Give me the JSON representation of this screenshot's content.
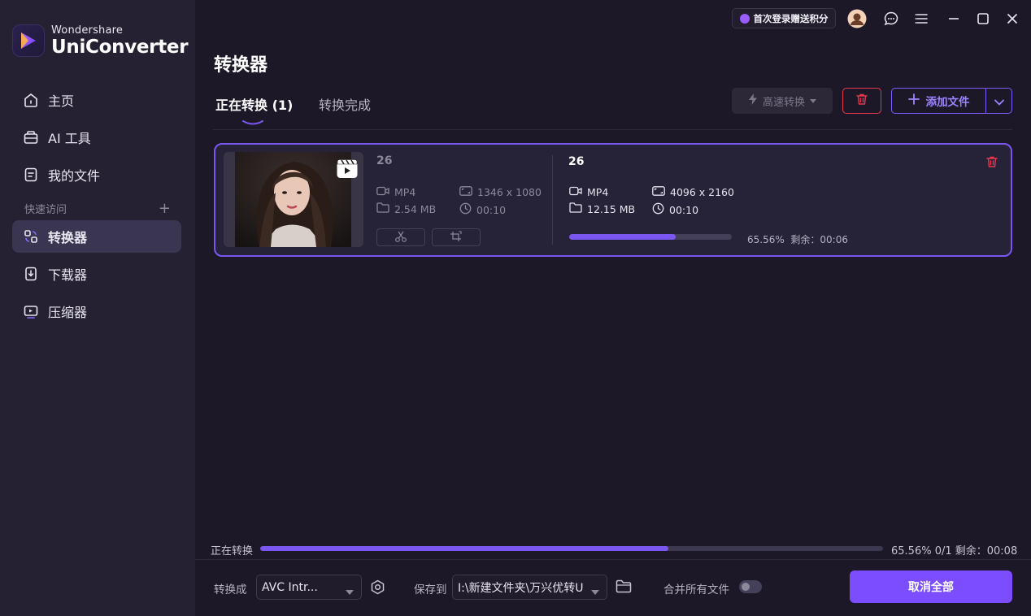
{
  "app": {
    "brand": "Wondershare",
    "product": "UniConverter"
  },
  "sidebar": {
    "items": [
      {
        "label": "主页",
        "icon": "home-icon"
      },
      {
        "label": "AI 工具",
        "icon": "ai-tools-icon"
      },
      {
        "label": "我的文件",
        "icon": "my-files-icon"
      },
      {
        "label": "转换器",
        "icon": "converter-icon",
        "active": true
      },
      {
        "label": "下载器",
        "icon": "downloader-icon"
      },
      {
        "label": "压缩器",
        "icon": "compressor-icon"
      }
    ],
    "quick_access_label": "快速访问",
    "quick_access_add": "+"
  },
  "topbar": {
    "promo_text": "首次登录赠送积分"
  },
  "main": {
    "title": "转换器",
    "tabs": [
      {
        "label": "正在转换 (1)",
        "active": true
      },
      {
        "label": "转换完成",
        "active": false
      }
    ],
    "toolbar": {
      "fast_convert_label": "高速转换",
      "add_file_label": "添加文件"
    }
  },
  "file": {
    "source": {
      "name": "26",
      "format": "MP4",
      "resolution": "1346 x 1080",
      "size": "2.54 MB",
      "duration": "00:10"
    },
    "output": {
      "name": "26",
      "format": "MP4",
      "resolution": "4096 x 2160",
      "size": "12.15 MB",
      "duration": "00:10"
    },
    "progress": {
      "percent": 65.56,
      "text": "65.56%",
      "remaining": "剩余：00:06"
    }
  },
  "overall": {
    "label": "正在转换",
    "percent": 65.56,
    "text": "65.56% 0/1 剩余：00:08"
  },
  "footer": {
    "convert_to_label": "转换成",
    "convert_to_value": "AVC Intr...",
    "save_to_label": "保存到",
    "save_to_value": "I:\\新建文件夹\\万兴优转U",
    "merge_label": "合并所有文件",
    "merge_enabled": false,
    "cancel_all_label": "取消全部"
  },
  "colors": {
    "accent": "#7b57f2",
    "danger": "#e5384f",
    "background": "#1c1827",
    "sidebar": "#252132"
  }
}
